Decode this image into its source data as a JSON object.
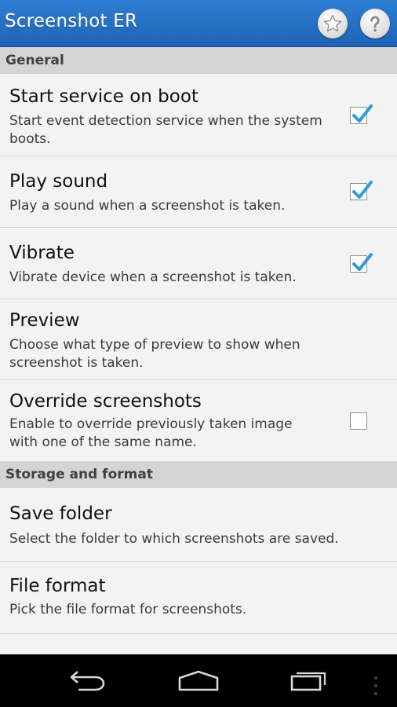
{
  "app": {
    "title": "Screenshot ER",
    "actions": [
      {
        "id": "rate",
        "icon": "star-icon"
      },
      {
        "id": "help",
        "icon": "question-icon"
      }
    ],
    "accent_color": "#2a77cc"
  },
  "sections": [
    {
      "title": "General",
      "items": [
        {
          "title": "Start service on boot",
          "summary": "Start event detection service when the system boots.",
          "checkbox": true,
          "checked": true
        },
        {
          "title": "Play sound",
          "summary": "Play a sound when a screenshot is taken.",
          "checkbox": true,
          "checked": true
        },
        {
          "title": "Vibrate",
          "summary": "Vibrate device when a screenshot is taken.",
          "checkbox": true,
          "checked": true
        },
        {
          "title": "Preview",
          "summary": "Choose what type of preview to show when screenshot is taken.",
          "checkbox": false
        },
        {
          "title": "Override screenshots",
          "summary": "Enable to override previously taken image with one of the same name.",
          "checkbox": true,
          "checked": false
        }
      ]
    },
    {
      "title": "Storage and format",
      "items": [
        {
          "title": "Save folder",
          "summary": "Select the folder to which screenshots are saved.",
          "checkbox": false
        },
        {
          "title": "File format",
          "summary": "Pick the file format for screenshots.",
          "checkbox": false
        }
      ]
    }
  ],
  "navigation": {
    "buttons": [
      {
        "id": "back",
        "icon": "back-arrow-icon"
      },
      {
        "id": "home",
        "icon": "home-icon"
      },
      {
        "id": "recents",
        "icon": "recent-apps-icon"
      },
      {
        "id": "menu",
        "icon": "overflow-menu-icon"
      }
    ]
  }
}
